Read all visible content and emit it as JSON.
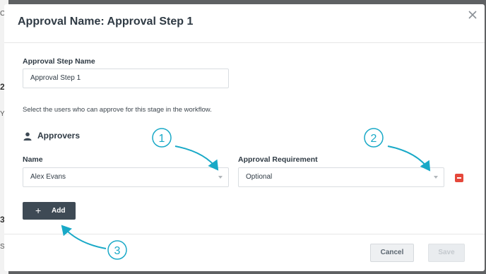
{
  "background_fragments": {
    "frag1": "Ca",
    "frag2": "2",
    "frag3": "Yo",
    "frag4": "3",
    "frag5": "Se"
  },
  "dialog": {
    "title": "Approval Name: Approval Step 1",
    "close_icon": "close-icon"
  },
  "form": {
    "step_name_label": "Approval Step Name",
    "step_name_value": "Approval Step 1",
    "hint": "Select the users who can approve for this stage in the workflow.",
    "approvers_title": "Approvers",
    "approvers_icon": "person-icon",
    "name_label": "Name",
    "name_value": "Alex Evans",
    "requirement_label": "Approval Requirement",
    "requirement_value": "Optional",
    "remove_icon": "minus-icon",
    "add_label": "Add"
  },
  "footer": {
    "cancel_label": "Cancel",
    "save_label": "Save"
  },
  "callouts": [
    "1",
    "2",
    "3"
  ],
  "colors": {
    "accent": "#19a9c7",
    "danger": "#e5483b",
    "primary_dark": "#3e4a55"
  }
}
